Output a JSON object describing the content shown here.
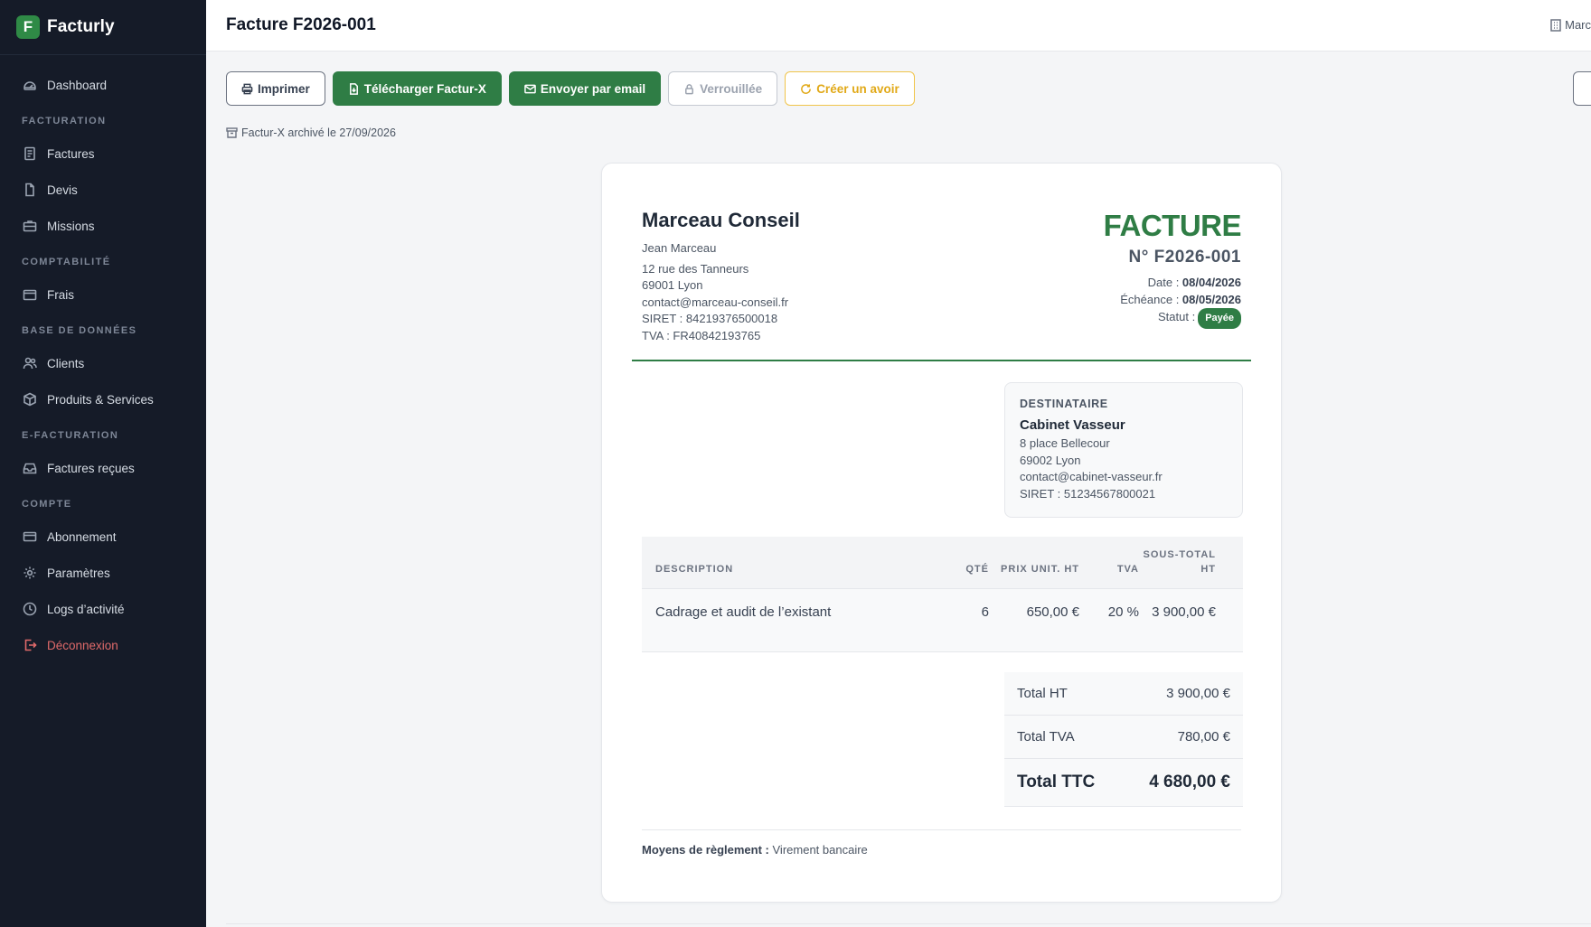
{
  "app": {
    "logo_letter": "F",
    "name": "Facturly"
  },
  "sidebar": {
    "dashboard": "Dashboard",
    "sections": {
      "facturation": "FACTURATION",
      "comptabilite": "COMPTABILITÉ",
      "base": "BASE DE DONNÉES",
      "efacturation": "E-FACTURATION",
      "compte": "COMPTE"
    },
    "items": {
      "factures": "Factures",
      "devis": "Devis",
      "missions": "Missions",
      "frais": "Frais",
      "clients": "Clients",
      "produits": "Produits & Services",
      "factures_recues": "Factures reçues",
      "abonnement": "Abonnement",
      "parametres": "Paramètres",
      "logs": "Logs d’activité",
      "deconnexion": "Déconnexion"
    }
  },
  "header": {
    "title": "Facture F2026-001",
    "user": "Marc"
  },
  "toolbar": {
    "print": "Imprimer",
    "download": "Télécharger Factur-X",
    "send": "Envoyer par email",
    "locked": "Verrouillée",
    "credit_note": "Créer un avoir"
  },
  "archive_note": "Factur-X archivé le 27/09/2026",
  "invoice": {
    "issuer": {
      "name": "Marceau Conseil",
      "contact_person": "Jean Marceau",
      "address1": "12 rue des Tanneurs",
      "address2": "69001 Lyon",
      "email": "contact@marceau-conseil.fr",
      "siret": "SIRET : 84219376500018",
      "tva": "TVA : FR40842193765"
    },
    "doc_type": "FACTURE",
    "number": "N° F2026-001",
    "date_label": "Date : ",
    "date": "08/04/2026",
    "due_label": "Échéance : ",
    "due": "08/05/2026",
    "status_label": "Statut :",
    "status": "Payée",
    "recipient": {
      "label": "DESTINATAIRE",
      "name": "Cabinet Vasseur",
      "address1": "8 place Bellecour",
      "address2": "69002 Lyon",
      "email": "contact@cabinet-vasseur.fr",
      "siret": "SIRET : 51234567800021"
    },
    "table": {
      "headers": {
        "description": "DESCRIPTION",
        "qty": "QTÉ",
        "unit_price": "PRIX UNIT. HT",
        "tva": "TVA",
        "subtotal": "SOUS-TOTAL HT"
      },
      "rows": [
        {
          "description": "Cadrage et audit de l’existant",
          "qty": "6",
          "unit_price": "650,00 €",
          "tva": "20 %",
          "subtotal": "3 900,00 €"
        }
      ]
    },
    "totals": {
      "ht_label": "Total HT",
      "ht": "3 900,00 €",
      "tva_label": "Total TVA",
      "tva": "780,00 €",
      "ttc_label": "Total TTC",
      "ttc": "4 680,00 €"
    },
    "payment_label": "Moyens de règlement :",
    "payment": "Virement bancaire"
  },
  "colors": {
    "brand": "#2f7d45",
    "sidebar_bg": "#151b28",
    "warning": "#e1a918",
    "danger": "#e06a6a"
  }
}
